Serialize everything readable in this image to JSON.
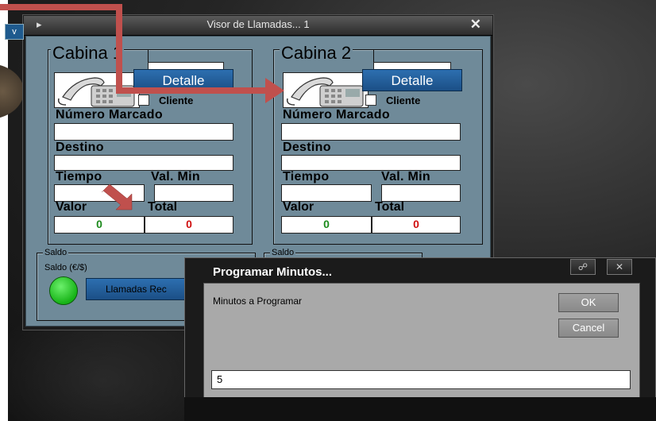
{
  "window": {
    "title": "Visor de Llamadas... 1",
    "menu_icon": "chevron-right-icon",
    "close_icon": "close-icon",
    "collapse_label": "v"
  },
  "cabinas": [
    {
      "name": "Cabina 1",
      "detalle_label": "Detalle",
      "cliente_label": "Cliente",
      "numero_label": "Número Marcado",
      "destino_label": "Destino",
      "tiempo_label": "Tiempo",
      "valmin_label": "Val. Min",
      "valor_label": "Valor",
      "total_label": "Total",
      "valor": "0",
      "total": "0"
    },
    {
      "name": "Cabina 2",
      "detalle_label": "Detalle",
      "cliente_label": "Cliente",
      "numero_label": "Número Marcado",
      "destino_label": "Destino",
      "tiempo_label": "Tiempo",
      "valmin_label": "Val. Min",
      "valor_label": "Valor",
      "total_label": "Total",
      "valor": "0",
      "total": "0"
    }
  ],
  "saldo": {
    "legend": "Saldo",
    "label": "Saldo (€/$)",
    "llamadas_button": "Llamadas Rec",
    "legend2": "Saldo"
  },
  "dialog": {
    "title": "Programar Minutos...",
    "prompt": "Minutos a Programar",
    "ok": "OK",
    "cancel": "Cancel",
    "value": "5",
    "tb_pin": "☍",
    "tb_close": "✕"
  },
  "colors": {
    "panel": "#6f8a99",
    "annotation": "#c0504d",
    "button_blue": "#1b4f86",
    "green_value": "#1c8a1c",
    "red_value": "#d01010"
  }
}
